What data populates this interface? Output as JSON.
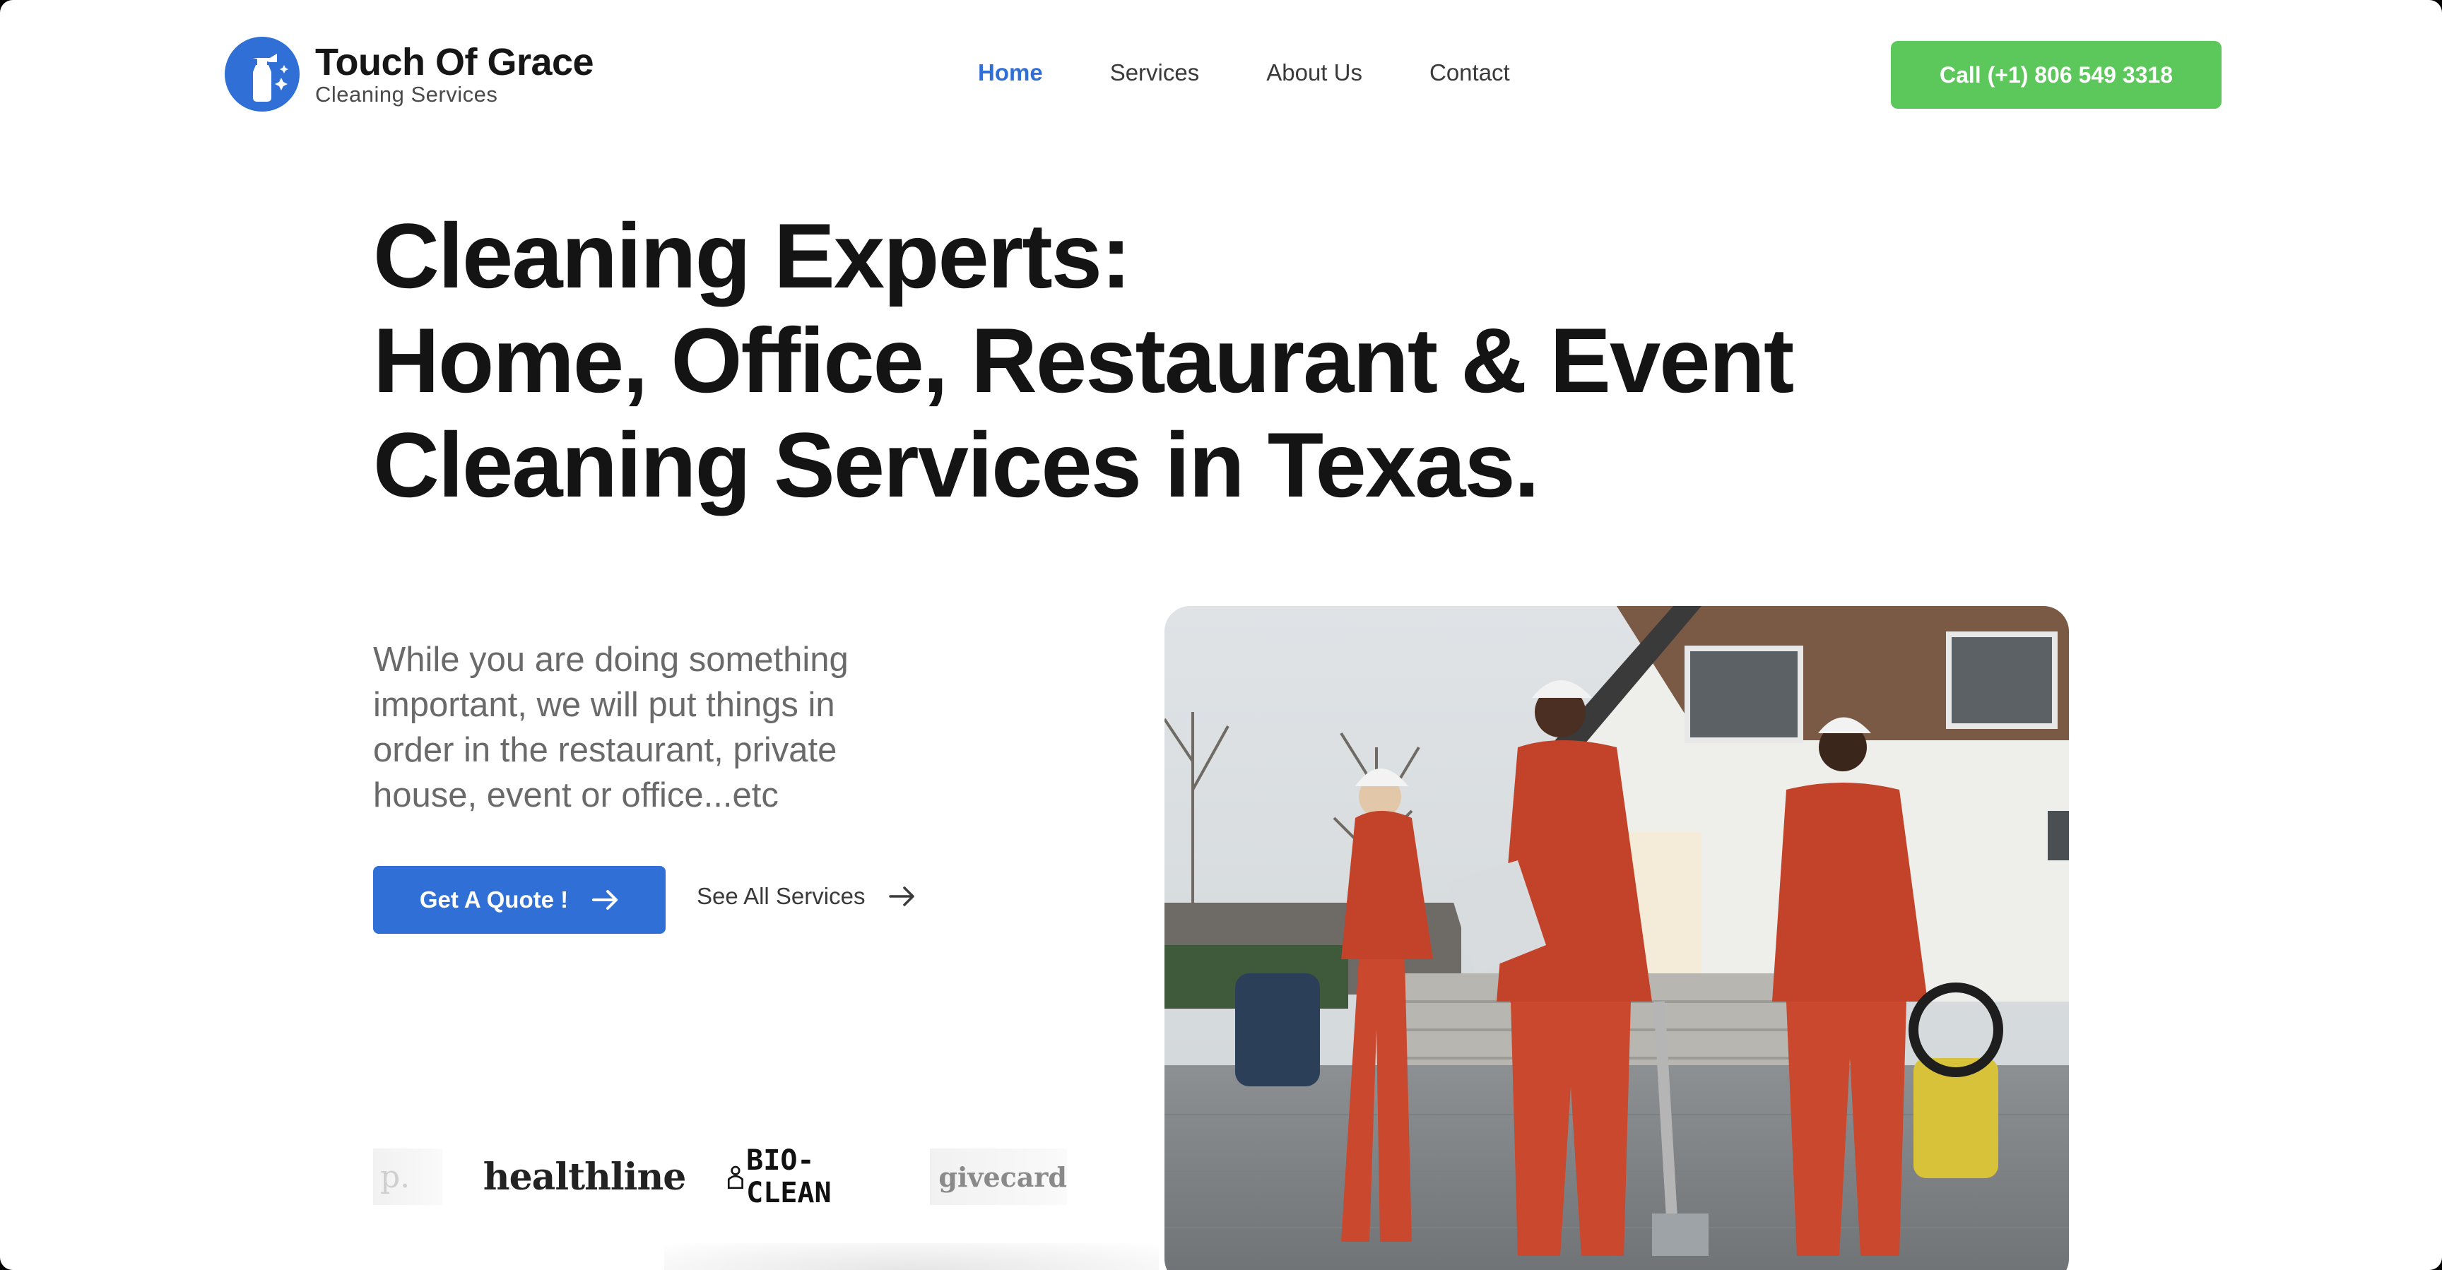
{
  "brand": {
    "name": "Touch Of Grace",
    "subtitle": "Cleaning Services",
    "logo_icon": "spray-bottle-icon",
    "accent": "#2f6fd6"
  },
  "nav": {
    "items": [
      {
        "label": "Home",
        "active": true
      },
      {
        "label": "Services",
        "active": false
      },
      {
        "label": "About Us",
        "active": false
      },
      {
        "label": "Contact",
        "active": false
      }
    ]
  },
  "header": {
    "call_label": "Call (+1) 806 549 3318",
    "call_color": "#5cc75a"
  },
  "hero": {
    "headline_lines": [
      "Cleaning Experts:",
      "Home, Office, Restaurant & Event",
      "Cleaning Services in Texas."
    ],
    "lead": "While you are doing something important, we will put things in order in the restaurant, private house, event or office...etc",
    "quote_button": "Get A Quote !",
    "services_link": "See All Services",
    "arrow_icon": "arrow-right-icon"
  },
  "partners": {
    "logos": [
      {
        "text": "p.",
        "partial": true
      },
      {
        "text": "healthline"
      },
      {
        "text": "BIO-CLEAN"
      },
      {
        "text": "givecard"
      }
    ]
  }
}
